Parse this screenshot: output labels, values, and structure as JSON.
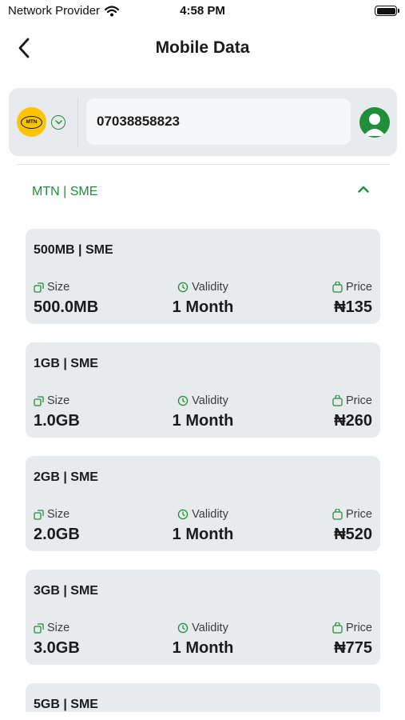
{
  "status_bar": {
    "carrier": "Network Provider",
    "time": "4:58 PM",
    "icons": [
      "wifi-icon",
      "battery-icon"
    ]
  },
  "header": {
    "title": "Mobile Data",
    "back_icon": "chevron-left-icon"
  },
  "recipient": {
    "network_logo_text": "MTN",
    "network_dropdown_icon": "chevron-down-circle-icon",
    "phone_number": "07038858823",
    "contact_icon": "user-avatar-icon"
  },
  "plan_group": {
    "title": "MTN | SME",
    "expanded_icon": "chevron-up-icon"
  },
  "labels": {
    "size": "Size",
    "validity": "Validity",
    "price": "Price"
  },
  "plans": [
    {
      "name": "500MB | SME",
      "size": "500.0MB",
      "validity": "1 Month",
      "price": "₦135"
    },
    {
      "name": "1GB | SME",
      "size": "1.0GB",
      "validity": "1 Month",
      "price": "₦260"
    },
    {
      "name": "2GB | SME",
      "size": "2.0GB",
      "validity": "1 Month",
      "price": "₦520"
    },
    {
      "name": "3GB | SME",
      "size": "3.0GB",
      "validity": "1 Month",
      "price": "₦775"
    },
    {
      "name": "5GB | SME"
    }
  ],
  "colors": {
    "accent_green": "#1f8f3a",
    "mtn_yellow": "#ffc403",
    "card_bg": "#e7ebee"
  }
}
